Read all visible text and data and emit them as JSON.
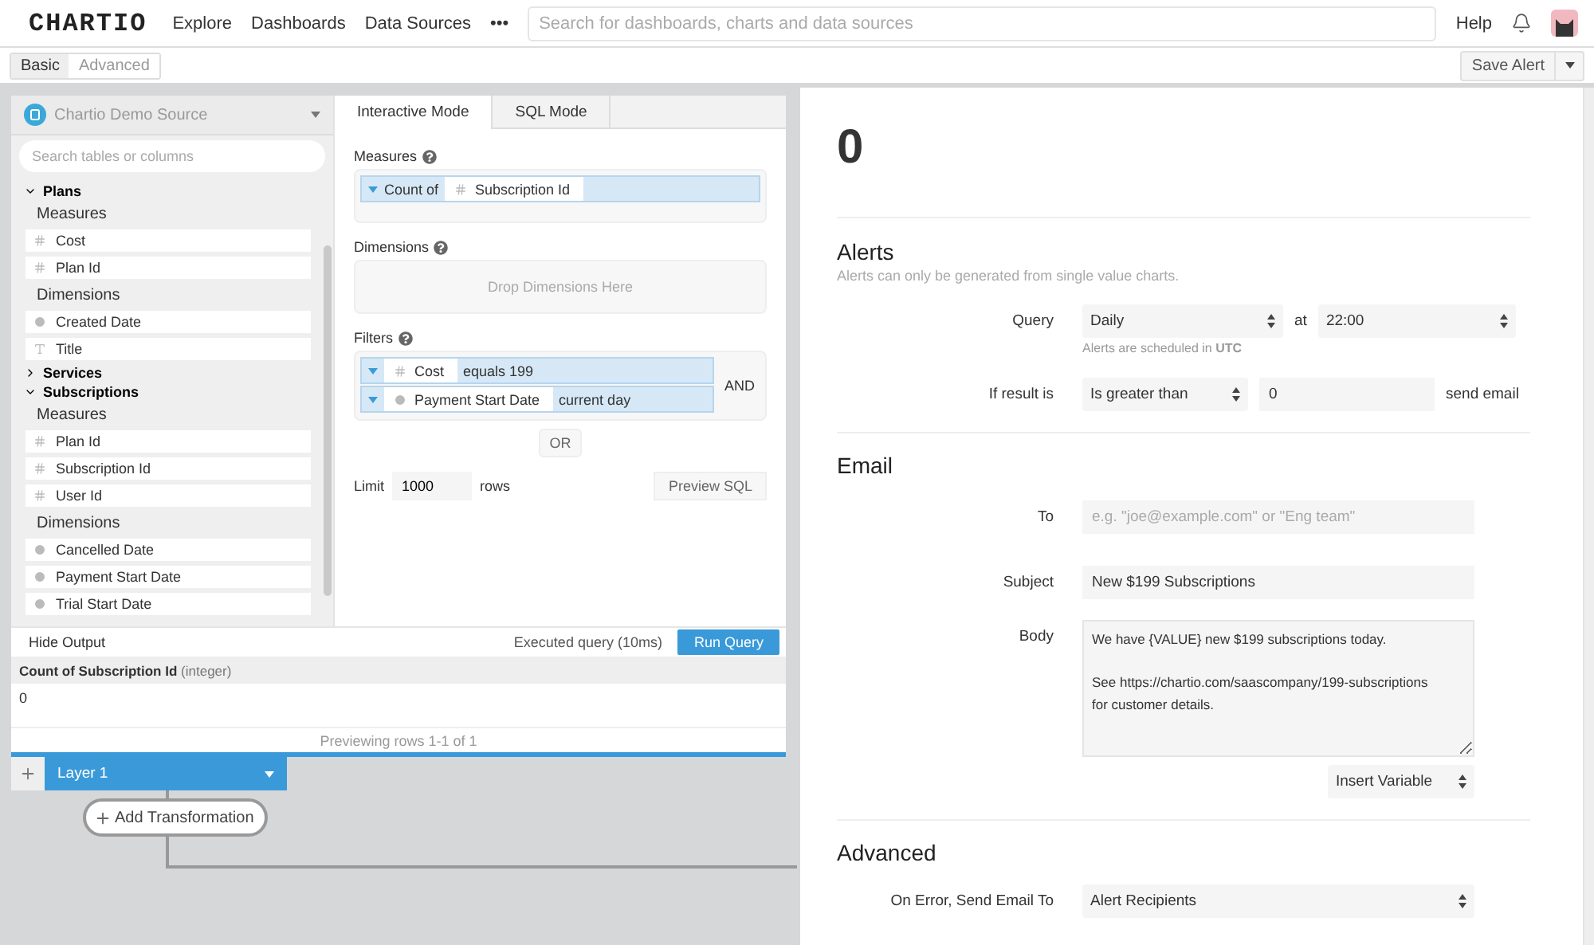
{
  "nav": {
    "logo": "CHARTIO",
    "links": [
      "Explore",
      "Dashboards",
      "Data Sources"
    ],
    "more": "•••",
    "search_placeholder": "Search for dashboards, charts and data sources",
    "help": "Help"
  },
  "mode_tabs": [
    {
      "label": "Basic",
      "selected": true
    },
    {
      "label": "Advanced",
      "selected": false
    }
  ],
  "save_button": "Save Alert",
  "source": "Chartio Demo Source",
  "table_search_placeholder": "Search tables or columns",
  "tables": [
    {
      "name": "Plans",
      "expanded": true,
      "groups": [
        {
          "title": "Measures",
          "columns": [
            {
              "kind": "number",
              "name": "Cost"
            },
            {
              "kind": "number",
              "name": "Plan Id"
            }
          ]
        },
        {
          "title": "Dimensions",
          "columns": [
            {
              "kind": "date",
              "name": "Created Date"
            },
            {
              "kind": "text",
              "name": "Title"
            }
          ]
        }
      ]
    },
    {
      "name": "Services",
      "expanded": false
    },
    {
      "name": "Subscriptions",
      "expanded": true,
      "groups": [
        {
          "title": "Measures",
          "columns": [
            {
              "kind": "number",
              "name": "Plan Id"
            },
            {
              "kind": "number",
              "name": "Subscription Id"
            },
            {
              "kind": "number",
              "name": "User Id"
            }
          ]
        },
        {
          "title": "Dimensions",
          "columns": [
            {
              "kind": "date",
              "name": "Cancelled Date"
            },
            {
              "kind": "date",
              "name": "Payment Start Date"
            },
            {
              "kind": "date",
              "name": "Trial Start Date"
            }
          ]
        }
      ]
    }
  ],
  "builder_tabs": [
    {
      "label": "Interactive Mode",
      "selected": true
    },
    {
      "label": "SQL Mode",
      "selected": false
    }
  ],
  "measures": {
    "label": "Measures",
    "items": [
      {
        "aggregate": "Count of",
        "kind": "number",
        "column": "Subscription Id"
      }
    ]
  },
  "dimensions": {
    "label": "Dimensions",
    "placeholder": "Drop Dimensions Here"
  },
  "filters": {
    "label": "Filters",
    "joiner": "AND",
    "or_button": "OR",
    "items": [
      {
        "kind": "number",
        "column": "Cost",
        "condition": "equals 199"
      },
      {
        "kind": "date",
        "column": "Payment Start Date",
        "condition": "current day"
      }
    ]
  },
  "limit": {
    "label": "Limit",
    "value": "1000",
    "unit": "rows",
    "preview_button": "Preview SQL"
  },
  "output": {
    "hide_button": "Hide Output",
    "status": "Executed query (10ms)",
    "run_button": "Run Query",
    "column": "Count of Subscription Id",
    "column_type": "(integer)",
    "rows": [
      [
        "0"
      ]
    ],
    "footer": "Previewing rows 1-1 of 1"
  },
  "layers": {
    "tabs": [
      {
        "label": "Layer 1",
        "selected": true
      }
    ],
    "add_transformation": "Add Transformation"
  },
  "alert_panel": {
    "value": "0",
    "alerts": {
      "title": "Alerts",
      "subtitle": "Alerts can only be generated from single value charts.",
      "query_label": "Query",
      "frequency": "Daily",
      "at": "at",
      "time": "22:00",
      "hint": "Alerts are scheduled in **UTC**",
      "condition_label": "If result is",
      "operator": "Is greater than",
      "threshold": "0",
      "suffix": "send email"
    },
    "email": {
      "title": "Email",
      "to_label": "To",
      "to_placeholder": "e.g. \"joe@example.com\" or \"Eng team\"",
      "subject_label": "Subject",
      "subject": "New $199 Subscriptions",
      "body_label": "Body",
      "body": "We have {VALUE} new $199 subscriptions today.\n\nSee https://chartio.com/saascompany/199-subscriptions\nfor customer details.",
      "insert_variable": "Insert Variable"
    },
    "advanced": {
      "title": "Advanced",
      "on_error_label": "On Error, Send Email To",
      "on_error": "Alert Recipients"
    }
  }
}
